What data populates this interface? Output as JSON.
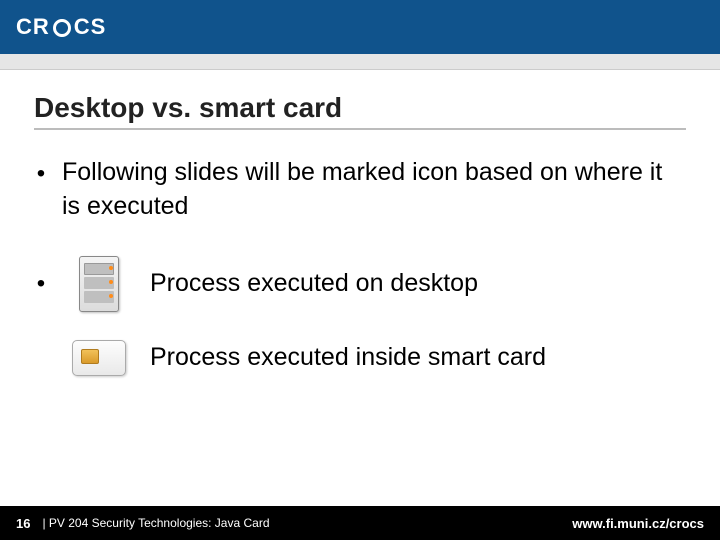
{
  "header": {
    "logo_text": "CR  CS"
  },
  "title": "Desktop vs. smart card",
  "bullet_main": "Following slides will be marked icon based on where it is executed",
  "rows": {
    "desktop_label": "Process executed on desktop",
    "smartcard_label": "Process executed inside smart card"
  },
  "footer": {
    "page_number": "16",
    "course": "| PV 204 Security Technologies: Java Card",
    "url": "www.fi.muni.cz/crocs"
  }
}
